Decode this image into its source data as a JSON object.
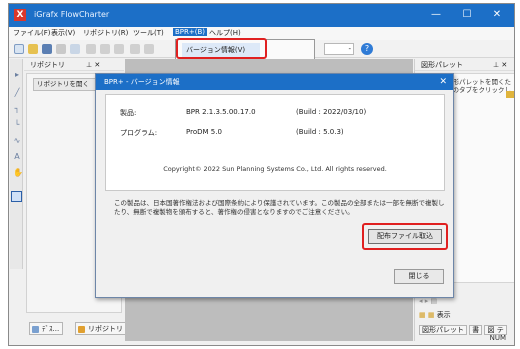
{
  "app": {
    "title": "iGrafx FlowCharter",
    "icon_letter": "X",
    "controls": {
      "minimize": "—",
      "maximize": "☐",
      "close": "✕"
    }
  },
  "menu": {
    "items": [
      "ファイル(F)",
      "表示(V)",
      "リポジトリ(R)",
      "ツール(T)",
      "BPR+(B)",
      "ヘルプ(H)"
    ],
    "active_index": 4,
    "dropdown_item": "バージョン情報(V)"
  },
  "toolbar": {
    "zoom": "-",
    "help_symbol": "?"
  },
  "repository_panel": {
    "title": "リポジトリ",
    "pin": "⊥ ✕",
    "open_button": "リポジトリを開く",
    "tabs": [
      "ﾃﾞｽ...",
      "リポジトリ"
    ]
  },
  "right_panel": {
    "title": "図形パレット",
    "pin": "⊥ ✕",
    "hint": "図形パレットを開くためのタブをクリックし",
    "view_label": "表示",
    "tabs": [
      "図形パレット",
      "書",
      "図 テ"
    ],
    "status": "NUM"
  },
  "colors": {
    "titlebar": "#1c6fc7",
    "highlight_outline": "#e02020",
    "canvas": "#bdbdbd"
  },
  "dialog": {
    "title": "BPR+ - バージョン情報",
    "close": "✕",
    "product_label": "製品:",
    "product_value": "BPR 2.1.3.5.00.17.0",
    "product_build": "(Build : 2022/03/10)",
    "program_label": "プログラム:",
    "program_value": "ProDM 5.0",
    "program_build": "(Build : 5.0.3)",
    "copyright": "Copyright© 2022 Sun Planning Systems Co., Ltd. All rights reserved.",
    "notice": "この製品は、日本国著作権法および国際条約により保護されています。この製品の全部または一部を無断で複製したり、無断で複製物を頒布すると、著作権の侵害となりますのでご注意ください。",
    "config_button": "配布ファイル取込",
    "close_button": "閉じる"
  }
}
